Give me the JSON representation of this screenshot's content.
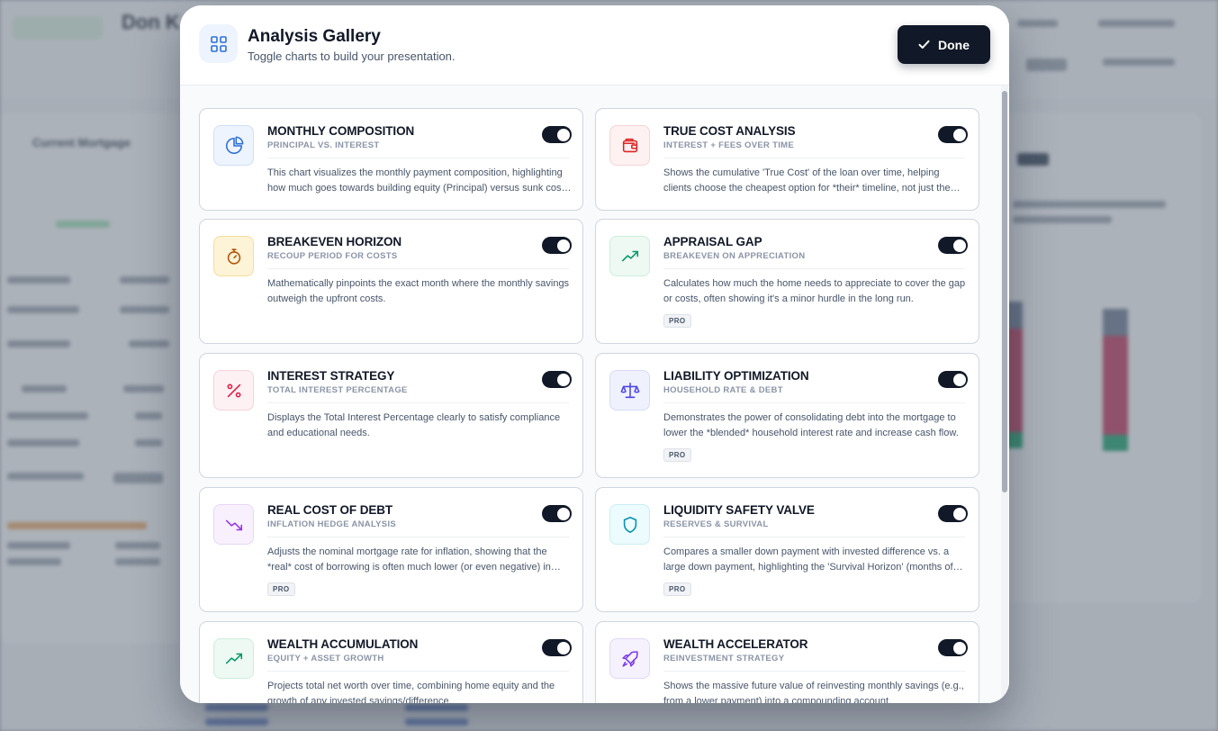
{
  "background": {
    "name_fragment": "Don K",
    "panel_title": "Current Mortgage"
  },
  "modal": {
    "title": "Analysis Gallery",
    "subtitle": "Toggle charts to build your presentation.",
    "done_label": "Done"
  },
  "cards": [
    {
      "title": "MONTHLY COMPOSITION",
      "subtitle": "PRINCIPAL VS. INTEREST",
      "description": "This chart visualizes the monthly payment composition, highlighting how much goes towards building equity (Principal) versus sunk costs (Interest).",
      "icon": "pie-chart-icon",
      "badge": "",
      "enabled": true,
      "colors": {
        "bg": "#eef4fd",
        "border": "#cfe0f7",
        "stroke": "#2f6fd6"
      }
    },
    {
      "title": "TRUE COST ANALYSIS",
      "subtitle": "INTEREST + FEES OVER TIME",
      "description": "Shows the cumulative 'True Cost' of the loan over time, helping clients choose the cheapest option for *their* timeline, not just the lowest rate.",
      "icon": "wallet-icon",
      "badge": "",
      "enabled": true,
      "colors": {
        "bg": "#fdf1f1",
        "border": "#f6d4d4",
        "stroke": "#dc2626"
      }
    },
    {
      "title": "BREAKEVEN HORIZON",
      "subtitle": "RECOUP PERIOD FOR COSTS",
      "description": "Mathematically pinpoints the exact month where the monthly savings outweigh the upfront costs.",
      "icon": "timer-icon",
      "badge": "",
      "enabled": true,
      "colors": {
        "bg": "#fdf3d6",
        "border": "#f4de9c",
        "stroke": "#b45309"
      }
    },
    {
      "title": "APPRAISAL GAP",
      "subtitle": "BREAKEVEN ON APPRECIATION",
      "description": "Calculates how much the home needs to appreciate to cover the gap or costs, often showing it's a minor hurdle in the long run.",
      "icon": "trending-up-icon",
      "badge": "PRO",
      "enabled": true,
      "colors": {
        "bg": "#edf9f2",
        "border": "#cdeedb",
        "stroke": "#059669"
      }
    },
    {
      "title": "INTEREST STRATEGY",
      "subtitle": "TOTAL INTEREST PERCENTAGE",
      "description": "Displays the Total Interest Percentage clearly to satisfy compliance and educational needs.",
      "icon": "percent-icon",
      "badge": "",
      "enabled": true,
      "colors": {
        "bg": "#fdf1f3",
        "border": "#f6d3da",
        "stroke": "#e11d48"
      }
    },
    {
      "title": "LIABILITY OPTIMIZATION",
      "subtitle": "HOUSEHOLD RATE & DEBT",
      "description": "Demonstrates the power of consolidating debt into the mortgage to lower the *blended* household interest rate and increase cash flow.",
      "icon": "scale-icon",
      "badge": "PRO",
      "enabled": true,
      "colors": {
        "bg": "#eff1fd",
        "border": "#d6dbf6",
        "stroke": "#4f46e5"
      }
    },
    {
      "title": "REAL COST OF DEBT",
      "subtitle": "INFLATION HEDGE ANALYSIS",
      "description": "Adjusts the nominal mortgage rate for inflation, showing that the *real* cost of borrowing is often much lower (or even negative) in inflationary times.",
      "icon": "trending-down-icon",
      "badge": "PRO",
      "enabled": true,
      "colors": {
        "bg": "#f8f1fd",
        "border": "#e7d6f6",
        "stroke": "#9333ea"
      }
    },
    {
      "title": "LIQUIDITY SAFETY VALVE",
      "subtitle": "RESERVES & SURVIVAL",
      "description": "Compares a smaller down payment with invested difference vs. a large down payment, highlighting the 'Survival Horizon' (months of reserves).",
      "icon": "shield-icon",
      "badge": "PRO",
      "enabled": true,
      "colors": {
        "bg": "#ecfbfd",
        "border": "#c9eef4",
        "stroke": "#0891b2"
      }
    },
    {
      "title": "WEALTH ACCUMULATION",
      "subtitle": "EQUITY + ASSET GROWTH",
      "description": "Projects total net worth over time, combining home equity and the growth of any invested savings/difference.",
      "icon": "trending-up-icon",
      "badge": "",
      "enabled": true,
      "colors": {
        "bg": "#edf9f2",
        "border": "#cdeedb",
        "stroke": "#059669"
      }
    },
    {
      "title": "WEALTH ACCELERATOR",
      "subtitle": "REINVESTMENT STRATEGY",
      "description": "Shows the massive future value of reinvesting monthly savings (e.g., from a lower payment) into a compounding account.",
      "icon": "rocket-icon",
      "badge": "",
      "enabled": true,
      "colors": {
        "bg": "#f5f1fd",
        "border": "#e2d8f6",
        "stroke": "#7c3aed"
      }
    }
  ]
}
